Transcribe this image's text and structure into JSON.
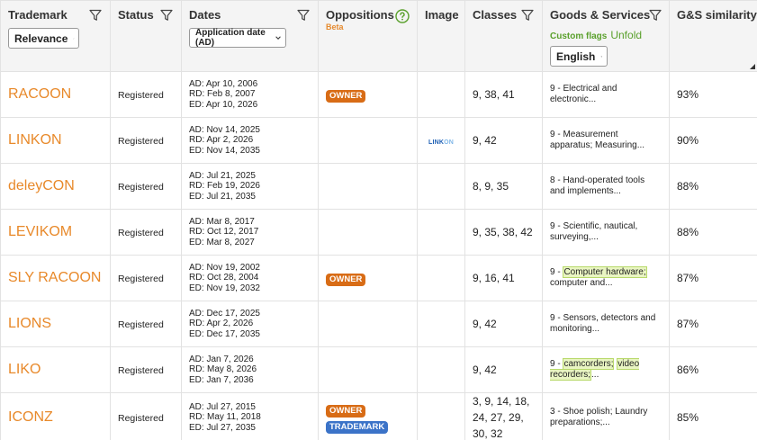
{
  "header": {
    "trademark": "Trademark",
    "relevance": "Relevance",
    "status": "Status",
    "dates": "Dates",
    "date_sort": "Application date (AD)",
    "oppositions": "Oppositions",
    "beta": "Beta",
    "image": "Image",
    "classes": "Classes",
    "goods": "Goods & Services",
    "custom_flags": "Custom flags",
    "unfold": "Unfold",
    "language": "English",
    "similarity": "G&S similarity"
  },
  "rows": [
    {
      "name": "RACOON",
      "status": "Registered",
      "ad": "AD: Apr 10, 2006",
      "rd": "RD: Feb 8, 2007",
      "ed": "ED: Apr 10, 2026",
      "badge1": "OWNER",
      "badge2": "",
      "logo": "",
      "classes": "9, 38, 41",
      "goods_prefix": "",
      "goods_hl1": "",
      "goods_hl2": "",
      "goods": "9 - Electrical and electronic...",
      "sim": "93%"
    },
    {
      "name": "LINKON",
      "status": "Registered",
      "ad": "AD: Nov 14, 2025",
      "rd": "RD: Apr 2, 2026",
      "ed": "ED: Nov 14, 2035",
      "badge1": "",
      "badge2": "",
      "logo": "LINKON",
      "classes": "9, 42",
      "goods_prefix": "",
      "goods_hl1": "",
      "goods_hl2": "",
      "goods": "9 - Measurement apparatus; Measuring...",
      "sim": "90%"
    },
    {
      "name": "deleyCON",
      "status": "Registered",
      "ad": "AD: Jul 21, 2025",
      "rd": "RD: Feb 19, 2026",
      "ed": "ED: Jul 21, 2035",
      "badge1": "",
      "badge2": "",
      "logo": "",
      "classes": "8, 9, 35",
      "goods_prefix": "",
      "goods_hl1": "",
      "goods_hl2": "",
      "goods": "8 - Hand-operated tools and implements...",
      "sim": "88%"
    },
    {
      "name": "LEVIKOM",
      "status": "Registered",
      "ad": "AD: Mar 8, 2017",
      "rd": "RD: Oct 12, 2017",
      "ed": "ED: Mar 8, 2027",
      "badge1": "",
      "badge2": "",
      "logo": "",
      "classes": "9, 35, 38, 42",
      "goods_prefix": "",
      "goods_hl1": "",
      "goods_hl2": "",
      "goods": "9 - Scientific, nautical, surveying,...",
      "sim": "88%"
    },
    {
      "name": "SLY RACOON",
      "status": "Registered",
      "ad": "AD: Nov 19, 2002",
      "rd": "RD: Oct 28, 2004",
      "ed": "ED: Nov 19, 2032",
      "badge1": "OWNER",
      "badge2": "",
      "logo": "",
      "classes": "9, 16, 41",
      "goods_prefix": "9 - ",
      "goods_hl1": "Computer hardware;",
      "goods_hl2": "",
      "goods": " computer and...",
      "sim": "87%"
    },
    {
      "name": "LIONS",
      "status": "Registered",
      "ad": "AD: Dec 17, 2025",
      "rd": "RD: Apr 2, 2026",
      "ed": "ED: Dec 17, 2035",
      "badge1": "",
      "badge2": "",
      "logo": "",
      "classes": "9, 42",
      "goods_prefix": "",
      "goods_hl1": "",
      "goods_hl2": "",
      "goods": "9 - Sensors, detectors and monitoring...",
      "sim": "87%"
    },
    {
      "name": "LIKO",
      "status": "Registered",
      "ad": "AD: Jan 7, 2026",
      "rd": "RD: May 8, 2026",
      "ed": "ED: Jan 7, 2036",
      "badge1": "",
      "badge2": "",
      "logo": "",
      "classes": "9, 42",
      "goods_prefix": "9 - ",
      "goods_hl1": "camcorders;",
      "goods_hl2": "video recorders;",
      "goods": "...",
      "sim": "86%"
    },
    {
      "name": "ICONZ",
      "status": "Registered",
      "ad": "AD: Jul 27, 2015",
      "rd": "RD: May 11, 2018",
      "ed": "ED: Jul 27, 2035",
      "badge1": "OWNER",
      "badge2": "TRADEMARK",
      "logo": "",
      "classes": "3, 9, 14, 18, 24, 27, 29, 30, 32",
      "goods_prefix": "",
      "goods_hl1": "",
      "goods_hl2": "",
      "goods": "3 - Shoe polish; Laundry preparations;...",
      "sim": "85%"
    }
  ],
  "colors": {
    "accent": "#e8892a",
    "owner_badge": "#d86c16",
    "trademark_badge": "#3b73c8",
    "flag_green": "#5aa02c"
  }
}
